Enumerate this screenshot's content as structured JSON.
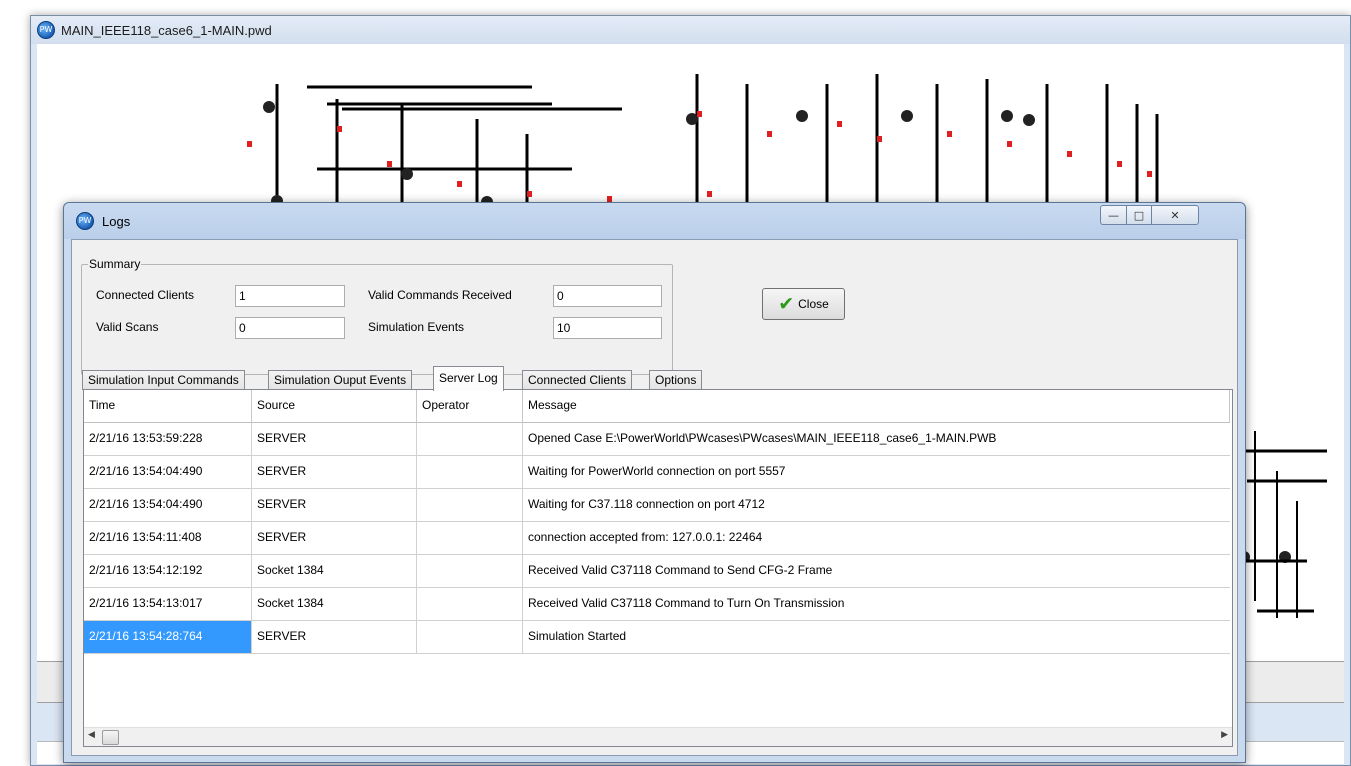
{
  "main_window": {
    "title": "MAIN_IEEE118_case6_1-MAIN.pwd"
  },
  "logs_window": {
    "title": "Logs",
    "window_buttons": {
      "minimize": "—",
      "maximize": "□",
      "close": "✕"
    }
  },
  "summary": {
    "group_label": "Summary",
    "connected_clients_label": "Connected Clients",
    "connected_clients_value": "1",
    "valid_scans_label": "Valid Scans",
    "valid_scans_value": "0",
    "valid_commands_label": "Valid Commands Received",
    "valid_commands_value": "0",
    "simulation_events_label": "Simulation Events",
    "simulation_events_value": "10"
  },
  "close_button": {
    "label": "Close",
    "icon": "checkmark-icon"
  },
  "tabs": [
    {
      "label": "Simulation Input Commands"
    },
    {
      "label": "Simulation Ouput Events"
    },
    {
      "label": "Server Log"
    },
    {
      "label": "Connected Clients"
    },
    {
      "label": "Options"
    }
  ],
  "active_tab": "Server Log",
  "log_table": {
    "columns": [
      "Time",
      "Source",
      "Operator",
      "Message"
    ],
    "rows": [
      [
        "2/21/16 13:53:59:228",
        "SERVER",
        "",
        "Opened Case E:\\PowerWorld\\PWcases\\PWcases\\MAIN_IEEE118_case6_1-MAIN.PWB"
      ],
      [
        "2/21/16 13:54:04:490",
        "SERVER",
        "",
        "Waiting for PowerWorld connection on port 5557"
      ],
      [
        "2/21/16 13:54:04:490",
        "SERVER",
        "",
        "Waiting for C37.118 connection on port 4712"
      ],
      [
        "2/21/16 13:54:11:408",
        "SERVER",
        "",
        "connection accepted from: 127.0.0.1: 22464"
      ],
      [
        "2/21/16 13:54:12:192",
        "Socket  1384",
        "",
        "Received Valid C37118 Command to Send CFG-2 Frame"
      ],
      [
        "2/21/16 13:54:13:017",
        "Socket  1384",
        "",
        "Received Valid C37118 Command to Turn On Transmission"
      ],
      [
        "2/21/16 13:54:28:764",
        "SERVER",
        "",
        "Simulation Started"
      ]
    ],
    "selected_row": 6
  },
  "colors": {
    "selection": "#3399ff",
    "diagram_line": "#000000",
    "diagram_breaker": "#e02020"
  }
}
